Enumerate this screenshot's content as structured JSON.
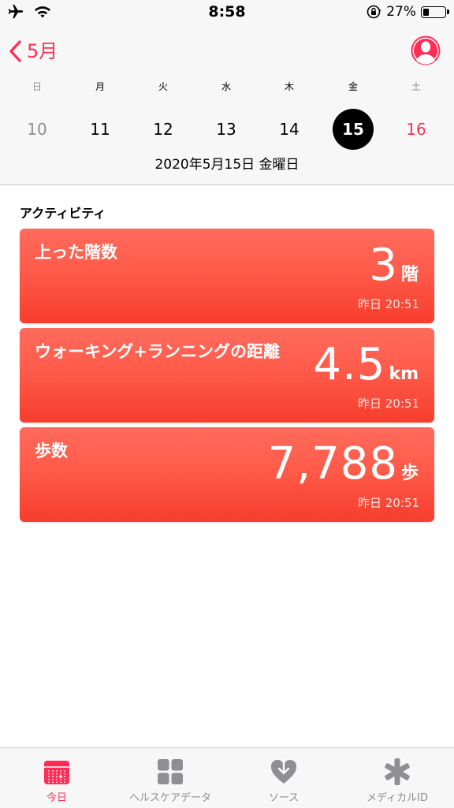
{
  "status": {
    "time": "8:58",
    "battery": "27%",
    "battery_level": 0.27
  },
  "nav": {
    "back_label": "5月"
  },
  "week": {
    "days": [
      {
        "name": "日",
        "num": "10"
      },
      {
        "name": "月",
        "num": "11"
      },
      {
        "name": "火",
        "num": "12"
      },
      {
        "name": "水",
        "num": "13"
      },
      {
        "name": "木",
        "num": "14"
      },
      {
        "name": "金",
        "num": "15"
      },
      {
        "name": "土",
        "num": "16"
      }
    ],
    "selected": "15"
  },
  "date_label": "2020年5月15日 金曜日",
  "activity": {
    "title": "アクティビティ",
    "cards": [
      {
        "title": "上った階数",
        "value": "3",
        "unit": "階",
        "time": "昨日 20:51"
      },
      {
        "title": "ウォーキング+ランニングの距離",
        "value": "4.5",
        "unit": "km",
        "time": "昨日 20:51"
      },
      {
        "title": "歩数",
        "value": "7,788",
        "unit": "歩",
        "time": "昨日 20:51"
      }
    ]
  },
  "tabs": [
    {
      "label": "今日",
      "icon": "today-icon",
      "active": true
    },
    {
      "label": "ヘルスケアデータ",
      "icon": "health-data-grid-icon",
      "active": false
    },
    {
      "label": "ソース",
      "icon": "sources-heart-icon",
      "active": false
    },
    {
      "label": "メディカルID",
      "icon": "medical-id-asterisk-icon",
      "active": false
    }
  ],
  "colors": {
    "accent": "#ff2d55",
    "card_top": "#ff6b5c",
    "card_bottom": "#f73d2c"
  }
}
